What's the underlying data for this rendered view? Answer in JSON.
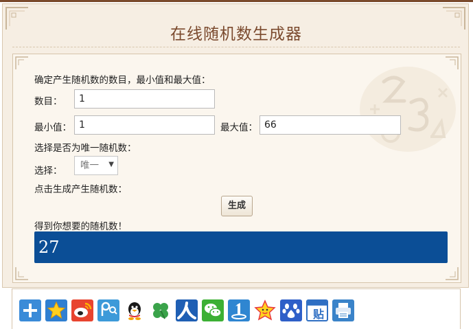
{
  "page": {
    "title": "在线随机数生成器"
  },
  "form": {
    "intro": "确定产生随机数的数目，最小值和最大值：",
    "count_label": "数目：",
    "count_value": "1",
    "min_label": "最小值：",
    "min_value": "1",
    "max_label": "最大值：",
    "max_value": "66",
    "unique_prompt": "选择是否为唯一随机数：",
    "select_label": "选择：",
    "select_value": "唯一",
    "generate_prompt": "点击生成产生随机数：",
    "generate_button": "生成",
    "result_label": "得到你想要的随机数！",
    "result_value": "27"
  },
  "share": {
    "icons": [
      "plus-share-icon",
      "star-favorite-icon",
      "weibo-icon",
      "qzone-icon",
      "qq-penguin-icon",
      "clover-icon",
      "renren-icon",
      "wechat-icon",
      "rank-one-icon",
      "star-smile-icon",
      "baidu-paw-icon",
      "tieba-icon",
      "print-icon"
    ],
    "tieba_glyph": "贴"
  },
  "colors": {
    "accent": "#7b4a2e",
    "result_bg": "#0b4e96",
    "panel_bg": "#fbf6ee"
  }
}
